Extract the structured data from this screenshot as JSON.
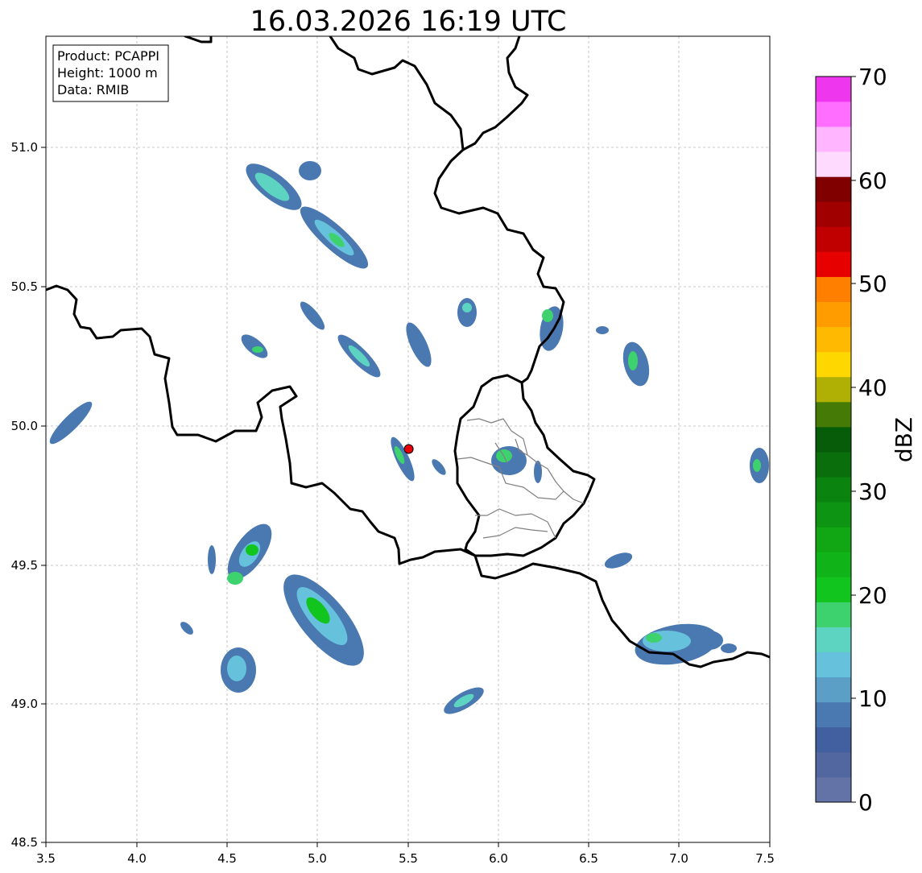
{
  "title": "16.03.2026 16:19 UTC",
  "info": {
    "product": "Product: PCAPPI",
    "height": "Height: 1000 m",
    "data": "Data: RMIB"
  },
  "map": {
    "lon_range": [
      3.5,
      7.5
    ],
    "lat_range": [
      48.5,
      51.4
    ],
    "x_ticks": [
      "3.5",
      "4.0",
      "4.5",
      "5.0",
      "5.5",
      "6.0",
      "6.5",
      "7.0",
      "7.5"
    ],
    "y_ticks": [
      "48.5",
      "49.0",
      "49.5",
      "50.0",
      "50.5",
      "51.0"
    ],
    "grid": true,
    "radar_site": {
      "lon": 5.505,
      "lat": 49.915,
      "color": "#e8000b"
    }
  },
  "colorbar": {
    "label": "dBZ",
    "range": [
      0,
      70
    ],
    "tick_labels": [
      "0",
      "10",
      "20",
      "30",
      "40",
      "50",
      "60",
      "70"
    ],
    "colors": [
      "#6373a8",
      "#52669f",
      "#425f9f",
      "#4a78b0",
      "#5b9ec6",
      "#66c1dc",
      "#5dd3c2",
      "#3ed26e",
      "#12c41e",
      "#10b418",
      "#10a614",
      "#0c9412",
      "#0b840f",
      "#096e0b",
      "#065c08",
      "#457a06",
      "#b0b004",
      "#ffd700",
      "#ffb900",
      "#ff9c00",
      "#ff7f00",
      "#e60000",
      "#c00000",
      "#a00000",
      "#800000",
      "#ffdaff",
      "#ffb5ff",
      "#ff6eff",
      "#ee36ee"
    ]
  }
}
